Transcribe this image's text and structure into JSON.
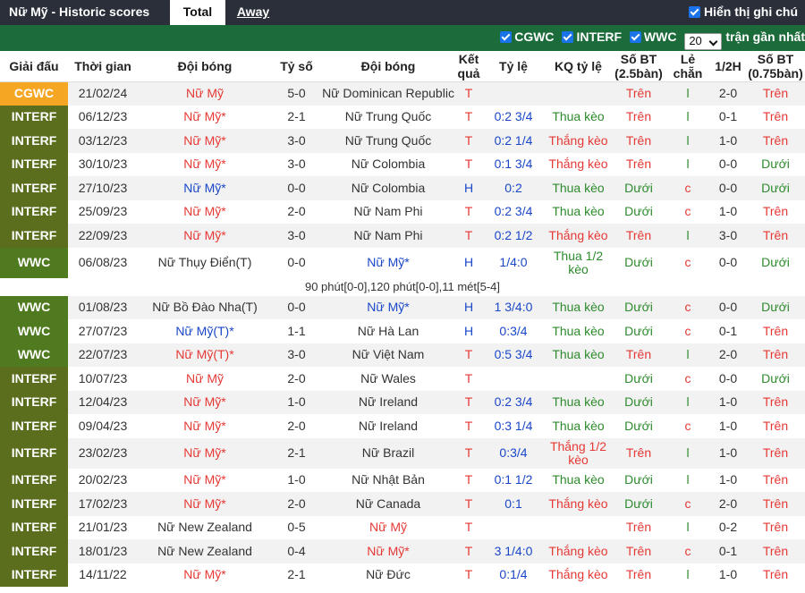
{
  "header": {
    "title": "Nữ Mỹ - Historic scores",
    "tabs": [
      "Total",
      "Away"
    ],
    "show_label": "Hiển thị ghi chú"
  },
  "filters": {
    "items": [
      "CGWC",
      "INTERF",
      "WWC"
    ],
    "count_value": "20",
    "recent_label": "trận gần nhất"
  },
  "colors": {
    "CGWC": "#f5a623",
    "INTERF": "#5a6e1e",
    "WWC": "#4f7a1f",
    "home": "#e53935",
    "neutral": "#1a47c8",
    "win": "#e53935",
    "loss": "#2e8b2e"
  },
  "columns": [
    "Giải đấu",
    "Thời gian",
    "Đội bóng",
    "Tỷ số",
    "Đội bóng",
    "Kết quả",
    "Tỷ lệ",
    "KQ tỷ lệ",
    "Số BT (2.5bàn)",
    "Lẻ chẵn",
    "1/2H",
    "Số BT (0.75bàn)"
  ],
  "rows": [
    {
      "league": "CGWC",
      "date": "21/02/24",
      "home": "Nữ Mỹ",
      "score": "5-0",
      "away": "Nữ Dominican Republic",
      "result": "T",
      "odds": "",
      "odds_result": "",
      "ou": "Trên",
      "oe": "l",
      "ht": "2-0",
      "ou075": "Trên",
      "home_color": "home",
      "away_color": "",
      "result_color": "win",
      "odds_color": "",
      "ou_color": "win",
      "oe_color": "loss",
      "ou075_color": "win",
      "tall": false
    },
    {
      "league": "INTERF",
      "date": "06/12/23",
      "home": "Nữ Mỹ*",
      "score": "2-1",
      "away": "Nữ Trung Quốc",
      "result": "T",
      "odds": "0:2 3/4",
      "odds_result": "Thua kèo",
      "ou": "Trên",
      "oe": "l",
      "ht": "0-1",
      "ou075": "Trên",
      "home_color": "home",
      "away_color": "",
      "result_color": "win",
      "odds_color": "loss",
      "ou_color": "win",
      "oe_color": "loss",
      "ou075_color": "win",
      "tall": false
    },
    {
      "league": "INTERF",
      "date": "03/12/23",
      "home": "Nữ Mỹ*",
      "score": "3-0",
      "away": "Nữ Trung Quốc",
      "result": "T",
      "odds": "0:2 1/4",
      "odds_result": "Thắng kèo",
      "ou": "Trên",
      "oe": "l",
      "ht": "1-0",
      "ou075": "Trên",
      "home_color": "home",
      "away_color": "",
      "result_color": "win",
      "odds_color": "win",
      "ou_color": "win",
      "oe_color": "loss",
      "ou075_color": "win",
      "tall": false
    },
    {
      "league": "INTERF",
      "date": "30/10/23",
      "home": "Nữ Mỹ*",
      "score": "3-0",
      "away": "Nữ Colombia",
      "result": "T",
      "odds": "0:1 3/4",
      "odds_result": "Thắng kèo",
      "ou": "Trên",
      "oe": "l",
      "ht": "0-0",
      "ou075": "Dưới",
      "home_color": "home",
      "away_color": "",
      "result_color": "win",
      "odds_color": "win",
      "ou_color": "win",
      "oe_color": "loss",
      "ou075_color": "loss",
      "tall": false
    },
    {
      "league": "INTERF",
      "date": "27/10/23",
      "home": "Nữ Mỹ*",
      "score": "0-0",
      "away": "Nữ Colombia",
      "result": "H",
      "odds": "0:2",
      "odds_result": "Thua kèo",
      "ou": "Dưới",
      "oe": "c",
      "ht": "0-0",
      "ou075": "Dưới",
      "home_color": "neutral",
      "away_color": "",
      "result_color": "neutral",
      "odds_color": "loss",
      "ou_color": "loss",
      "oe_color": "win",
      "ou075_color": "loss",
      "tall": false
    },
    {
      "league": "INTERF",
      "date": "25/09/23",
      "home": "Nữ Mỹ*",
      "score": "2-0",
      "away": "Nữ Nam Phi",
      "result": "T",
      "odds": "0:2 3/4",
      "odds_result": "Thua kèo",
      "ou": "Dưới",
      "oe": "c",
      "ht": "1-0",
      "ou075": "Trên",
      "home_color": "home",
      "away_color": "",
      "result_color": "win",
      "odds_color": "loss",
      "ou_color": "loss",
      "oe_color": "win",
      "ou075_color": "win",
      "tall": false
    },
    {
      "league": "INTERF",
      "date": "22/09/23",
      "home": "Nữ Mỹ*",
      "score": "3-0",
      "away": "Nữ Nam Phi",
      "result": "T",
      "odds": "0:2 1/2",
      "odds_result": "Thắng kèo",
      "ou": "Trên",
      "oe": "l",
      "ht": "3-0",
      "ou075": "Trên",
      "home_color": "home",
      "away_color": "",
      "result_color": "win",
      "odds_color": "win",
      "ou_color": "win",
      "oe_color": "loss",
      "ou075_color": "win",
      "tall": false
    },
    {
      "league": "WWC",
      "date": "06/08/23",
      "home": "Nữ Thụy Điển(T)",
      "score": "0-0",
      "away": "Nữ Mỹ*",
      "result": "H",
      "odds": "1/4:0",
      "odds_result": "Thua 1/2 kèo",
      "ou": "Dưới",
      "oe": "c",
      "ht": "0-0",
      "ou075": "Dưới",
      "home_color": "",
      "away_color": "neutral",
      "result_color": "neutral",
      "odds_color": "loss",
      "ou_color": "loss",
      "oe_color": "win",
      "ou075_color": "loss",
      "tall": true
    },
    {
      "league": "WWC",
      "date": "01/08/23",
      "home": "Nữ Bồ Đào Nha(T)",
      "score": "0-0",
      "away": "Nữ Mỹ*",
      "result": "H",
      "odds": "1 3/4:0",
      "odds_result": "Thua kèo",
      "ou": "Dưới",
      "oe": "c",
      "ht": "0-0",
      "ou075": "Dưới",
      "home_color": "",
      "away_color": "neutral",
      "result_color": "neutral",
      "odds_color": "loss",
      "ou_color": "loss",
      "oe_color": "win",
      "ou075_color": "loss",
      "tall": false
    },
    {
      "league": "WWC",
      "date": "27/07/23",
      "home": "Nữ Mỹ(T)*",
      "score": "1-1",
      "away": "Nữ Hà Lan",
      "result": "H",
      "odds": "0:3/4",
      "odds_result": "Thua kèo",
      "ou": "Dưới",
      "oe": "c",
      "ht": "0-1",
      "ou075": "Trên",
      "home_color": "neutral",
      "away_color": "",
      "result_color": "neutral",
      "odds_color": "loss",
      "ou_color": "loss",
      "oe_color": "win",
      "ou075_color": "win",
      "tall": false
    },
    {
      "league": "WWC",
      "date": "22/07/23",
      "home": "Nữ Mỹ(T)*",
      "score": "3-0",
      "away": "Nữ Việt Nam",
      "result": "T",
      "odds": "0:5 3/4",
      "odds_result": "Thua kèo",
      "ou": "Trên",
      "oe": "l",
      "ht": "2-0",
      "ou075": "Trên",
      "home_color": "home",
      "away_color": "",
      "result_color": "win",
      "odds_color": "loss",
      "ou_color": "win",
      "oe_color": "loss",
      "ou075_color": "win",
      "tall": false
    },
    {
      "league": "INTERF",
      "date": "10/07/23",
      "home": "Nữ Mỹ",
      "score": "2-0",
      "away": "Nữ Wales",
      "result": "T",
      "odds": "",
      "odds_result": "",
      "ou": "Dưới",
      "oe": "c",
      "ht": "0-0",
      "ou075": "Dưới",
      "home_color": "home",
      "away_color": "",
      "result_color": "win",
      "odds_color": "",
      "ou_color": "loss",
      "oe_color": "win",
      "ou075_color": "loss",
      "tall": false
    },
    {
      "league": "INTERF",
      "date": "12/04/23",
      "home": "Nữ Mỹ*",
      "score": "1-0",
      "away": "Nữ Ireland",
      "result": "T",
      "odds": "0:2 3/4",
      "odds_result": "Thua kèo",
      "ou": "Dưới",
      "oe": "l",
      "ht": "1-0",
      "ou075": "Trên",
      "home_color": "home",
      "away_color": "",
      "result_color": "win",
      "odds_color": "loss",
      "ou_color": "loss",
      "oe_color": "loss",
      "ou075_color": "win",
      "tall": false
    },
    {
      "league": "INTERF",
      "date": "09/04/23",
      "home": "Nữ Mỹ*",
      "score": "2-0",
      "away": "Nữ Ireland",
      "result": "T",
      "odds": "0:3 1/4",
      "odds_result": "Thua kèo",
      "ou": "Dưới",
      "oe": "c",
      "ht": "1-0",
      "ou075": "Trên",
      "home_color": "home",
      "away_color": "",
      "result_color": "win",
      "odds_color": "loss",
      "ou_color": "loss",
      "oe_color": "win",
      "ou075_color": "win",
      "tall": false
    },
    {
      "league": "INTERF",
      "date": "23/02/23",
      "home": "Nữ Mỹ*",
      "score": "2-1",
      "away": "Nữ Brazil",
      "result": "T",
      "odds": "0:3/4",
      "odds_result": "Thắng 1/2 kèo",
      "ou": "Trên",
      "oe": "l",
      "ht": "1-0",
      "ou075": "Trên",
      "home_color": "home",
      "away_color": "",
      "result_color": "win",
      "odds_color": "win",
      "ou_color": "win",
      "oe_color": "loss",
      "ou075_color": "win",
      "tall": true
    },
    {
      "league": "INTERF",
      "date": "20/02/23",
      "home": "Nữ Mỹ*",
      "score": "1-0",
      "away": "Nữ Nhật Bản",
      "result": "T",
      "odds": "0:1 1/2",
      "odds_result": "Thua kèo",
      "ou": "Dưới",
      "oe": "l",
      "ht": "1-0",
      "ou075": "Trên",
      "home_color": "home",
      "away_color": "",
      "result_color": "win",
      "odds_color": "loss",
      "ou_color": "loss",
      "oe_color": "loss",
      "ou075_color": "win",
      "tall": false
    },
    {
      "league": "INTERF",
      "date": "17/02/23",
      "home": "Nữ Mỹ*",
      "score": "2-0",
      "away": "Nữ Canada",
      "result": "T",
      "odds": "0:1",
      "odds_result": "Thắng kèo",
      "ou": "Dưới",
      "oe": "c",
      "ht": "2-0",
      "ou075": "Trên",
      "home_color": "home",
      "away_color": "",
      "result_color": "win",
      "odds_color": "win",
      "ou_color": "loss",
      "oe_color": "win",
      "ou075_color": "win",
      "tall": false
    },
    {
      "league": "INTERF",
      "date": "21/01/23",
      "home": "Nữ New Zealand",
      "score": "0-5",
      "away": "Nữ Mỹ",
      "result": "T",
      "odds": "",
      "odds_result": "",
      "ou": "Trên",
      "oe": "l",
      "ht": "0-2",
      "ou075": "Trên",
      "home_color": "",
      "away_color": "home",
      "result_color": "win",
      "odds_color": "",
      "ou_color": "win",
      "oe_color": "loss",
      "ou075_color": "win",
      "tall": false
    },
    {
      "league": "INTERF",
      "date": "18/01/23",
      "home": "Nữ New Zealand",
      "score": "0-4",
      "away": "Nữ Mỹ*",
      "result": "T",
      "odds": "3 1/4:0",
      "odds_result": "Thắng kèo",
      "ou": "Trên",
      "oe": "c",
      "ht": "0-1",
      "ou075": "Trên",
      "home_color": "",
      "away_color": "home",
      "result_color": "win",
      "odds_color": "win",
      "ou_color": "win",
      "oe_color": "win",
      "ou075_color": "win",
      "tall": false
    },
    {
      "league": "INTERF",
      "date": "14/11/22",
      "home": "Nữ Mỹ*",
      "score": "2-1",
      "away": "Nữ Đức",
      "result": "T",
      "odds": "0:1/4",
      "odds_result": "Thắng kèo",
      "ou": "Trên",
      "oe": "l",
      "ht": "1-0",
      "ou075": "Trên",
      "home_color": "home",
      "away_color": "",
      "result_color": "win",
      "odds_color": "win",
      "ou_color": "win",
      "oe_color": "loss",
      "ou075_color": "win",
      "tall": false
    }
  ],
  "notes": {
    "7": "90 phút[0-0],120 phút[0-0],11 mét[5-4]"
  }
}
